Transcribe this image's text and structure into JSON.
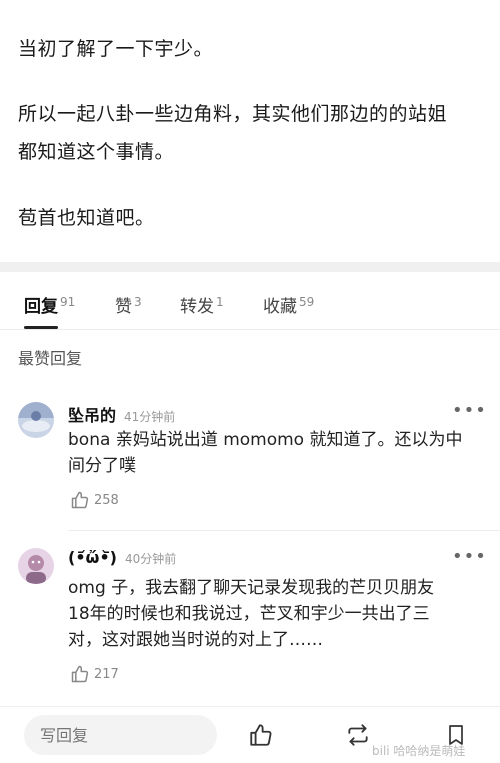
{
  "post": {
    "lines": [
      "当初了解了一下宇少。",
      "所以一起八卦一些边角料，其实他们那边的的站姐",
      "都知道这个事情。",
      "苞首也知道吧。"
    ]
  },
  "tabs": [
    {
      "label": "回复",
      "count": "91"
    },
    {
      "label": "赞",
      "count": "3"
    },
    {
      "label": "转发",
      "count": "1"
    },
    {
      "label": "收藏",
      "count": "59"
    }
  ],
  "section_title": "最赞回复",
  "comments": [
    {
      "user": "坠吊的",
      "time": "41分钟前",
      "more": "•••",
      "text_lines": [
        "bona 亲妈站说出道 momomo 就知道了。还以为中",
        "间分了噗"
      ],
      "likes": "258"
    },
    {
      "user": "(•᷄ὤ•᷅)",
      "time": "40分钟前",
      "more": "•••",
      "text_lines": [
        "omg 子，我去翻了聊天记录发现我的芒贝贝朋友",
        "18年的时候也和我说过，芒叉和宇少一共出了三",
        "对，这对跟她当时说的对上了……"
      ],
      "likes": "217"
    }
  ],
  "bottom_bar": {
    "reply_placeholder": "写回复"
  },
  "watermark": "bili 哈哈纳是萌娃",
  "colors": {
    "divider_band": "#f0f0f0",
    "text_primary": "#1a1a1a",
    "text_muted": "#999999"
  }
}
